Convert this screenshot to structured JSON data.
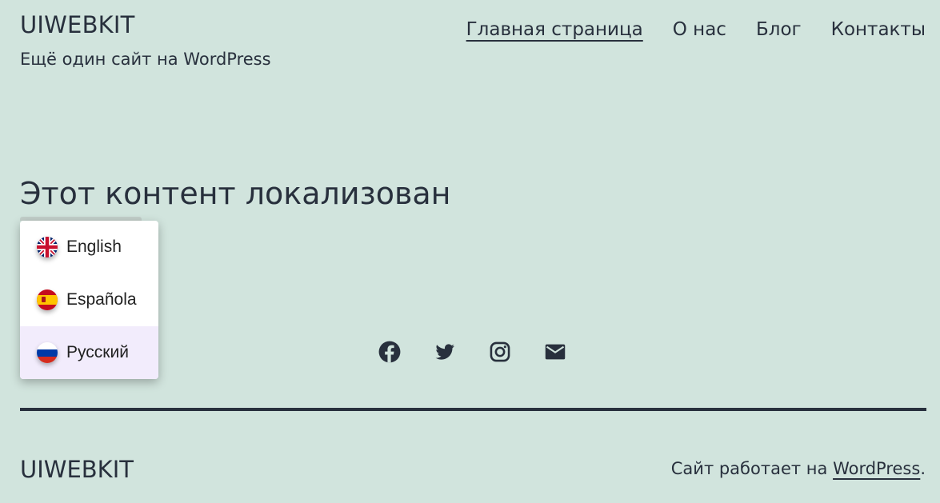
{
  "header": {
    "site_title": "UIWEBKIT",
    "tagline": "Ещё один сайт на WordPress",
    "nav": [
      "Главная страница",
      "О нас",
      "Блог",
      "Контакты"
    ]
  },
  "main": {
    "heading": "Этот контент локализован"
  },
  "language_menu": {
    "items": [
      {
        "label": "English",
        "flag": "uk-flag-icon"
      },
      {
        "label": "Española",
        "flag": "spain-flag-icon"
      },
      {
        "label": "Русский",
        "flag": "russia-flag-icon"
      }
    ],
    "selected": "Русский"
  },
  "social": [
    "facebook-icon",
    "twitter-icon",
    "instagram-icon",
    "mail-icon"
  ],
  "footer": {
    "site_title": "UIWEBKIT",
    "credit_prefix": "Сайт работает на ",
    "credit_link": "WordPress",
    "credit_suffix": "."
  },
  "colors": {
    "background": "#d1e4dd",
    "text": "#28303d",
    "menu_selected": "#f2ecfc"
  }
}
